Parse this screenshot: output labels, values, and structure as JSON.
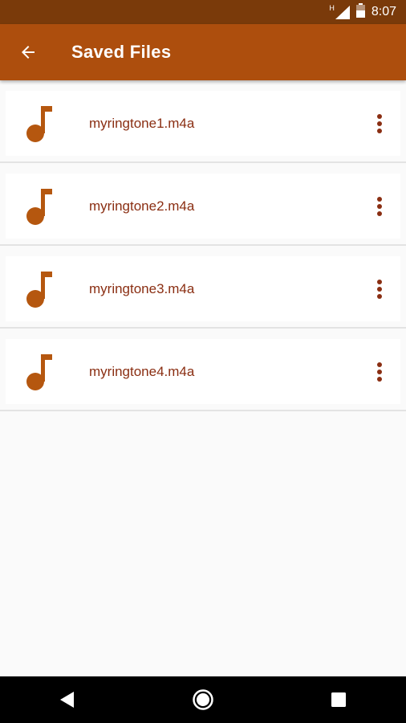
{
  "status_bar": {
    "time": "8:07",
    "network_type": "H",
    "signal_icon": "signal-icon",
    "battery_icon": "battery-icon"
  },
  "app_bar": {
    "title": "Saved Files",
    "back_icon": "arrow-back-icon"
  },
  "files": [
    {
      "name": "myringtone1.m4a",
      "icon": "music-note-icon"
    },
    {
      "name": "myringtone2.m4a",
      "icon": "music-note-icon"
    },
    {
      "name": "myringtone3.m4a",
      "icon": "music-note-icon"
    },
    {
      "name": "myringtone4.m4a",
      "icon": "music-note-icon"
    }
  ],
  "nav_bar": {
    "back": "nav-back-icon",
    "home": "nav-home-icon",
    "recents": "nav-recents-icon"
  },
  "colors": {
    "status_bar": "#7a3a0a",
    "app_bar": "#ad4e0d",
    "icon_brown": "#b5570f",
    "file_text": "#8a2e12",
    "menu_dots": "#8a2e12"
  }
}
